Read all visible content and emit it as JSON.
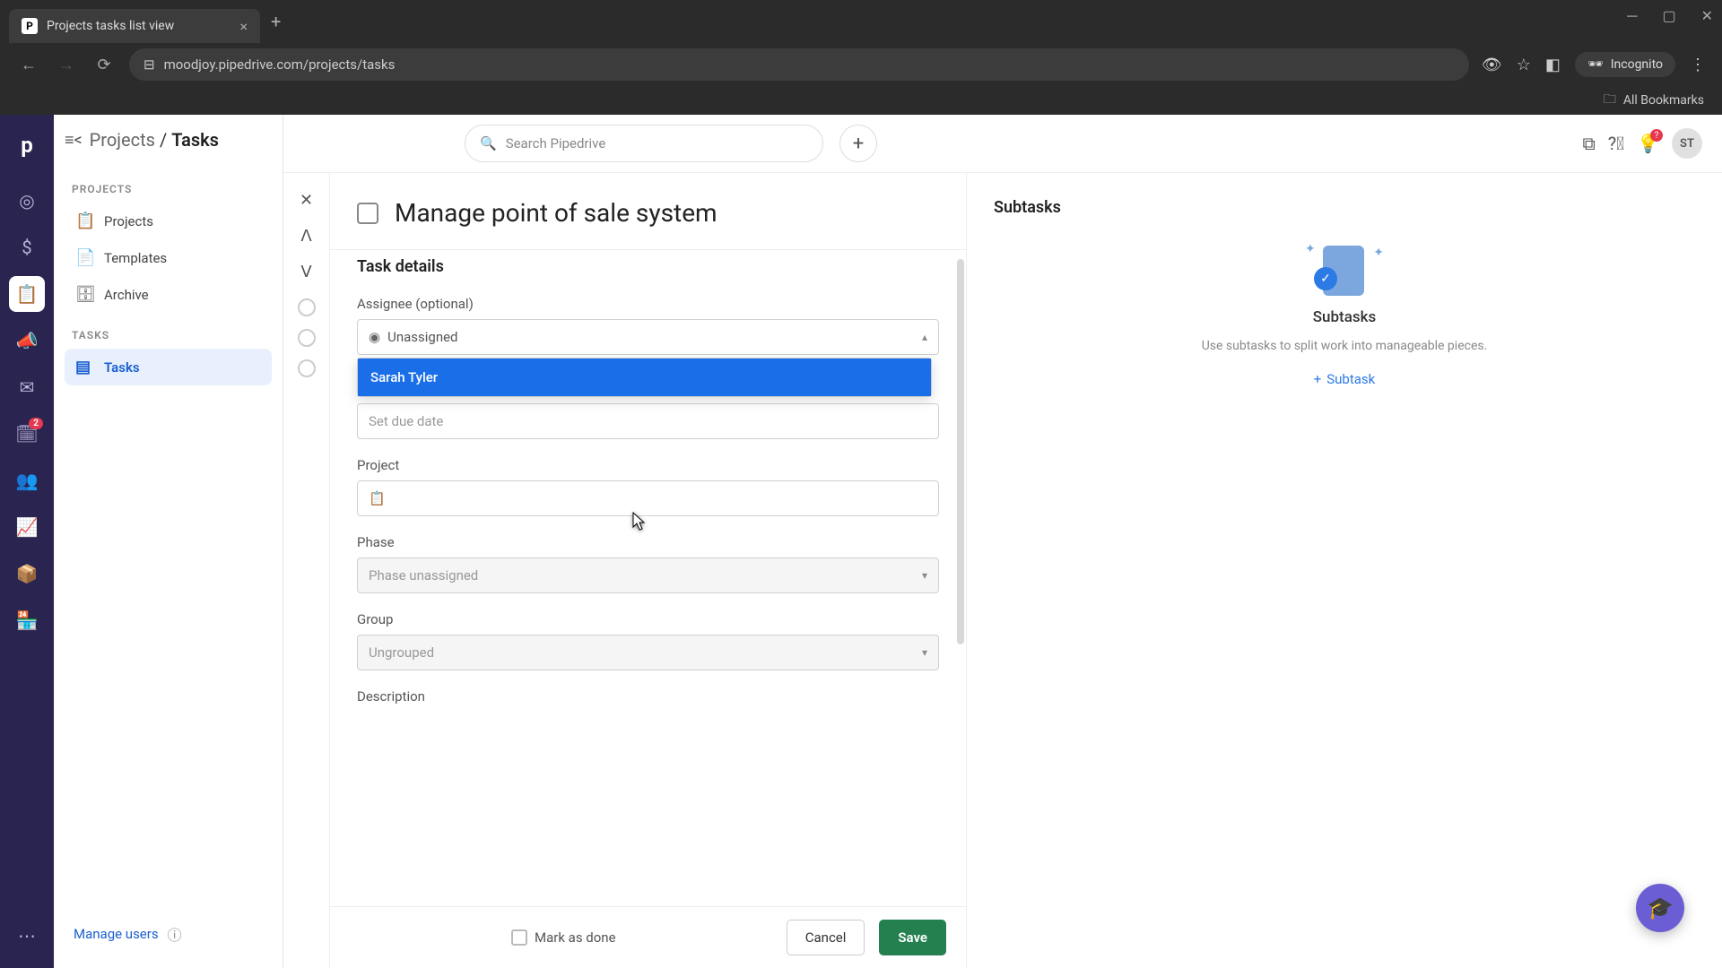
{
  "browser": {
    "tab_title": "Projects tasks list view",
    "url": "moodjoy.pipedrive.com/projects/tasks",
    "incognito_label": "Incognito",
    "all_bookmarks": "All Bookmarks"
  },
  "rail": {
    "badge": "2"
  },
  "sidebar": {
    "breadcrumb_parent": "Projects",
    "breadcrumb_sep": " / ",
    "breadcrumb_current": "Tasks",
    "sections": {
      "projects_label": "PROJECTS",
      "tasks_label": "TASKS"
    },
    "items": {
      "projects": "Projects",
      "templates": "Templates",
      "archive": "Archive",
      "tasks": "Tasks"
    },
    "footer_link": "Manage users"
  },
  "topbar": {
    "search_placeholder": "Search Pipedrive",
    "avatar_initials": "ST",
    "tip_badge": "?"
  },
  "task": {
    "title": "Manage point of sale system",
    "details_heading": "Task details",
    "assignee_label": "Assignee (optional)",
    "assignee_value": "Unassigned",
    "assignee_option_1": "Sarah Tyler",
    "due_placeholder": "Set due date",
    "project_label": "Project",
    "phase_label": "Phase",
    "phase_value": "Phase unassigned",
    "group_label": "Group",
    "group_value": "Ungrouped",
    "description_label": "Description",
    "mark_done": "Mark as done",
    "cancel": "Cancel",
    "save": "Save"
  },
  "subtasks": {
    "heading": "Subtasks",
    "empty_title": "Subtasks",
    "empty_desc": "Use subtasks to split work into manageable pieces.",
    "add_label": "Subtask"
  }
}
